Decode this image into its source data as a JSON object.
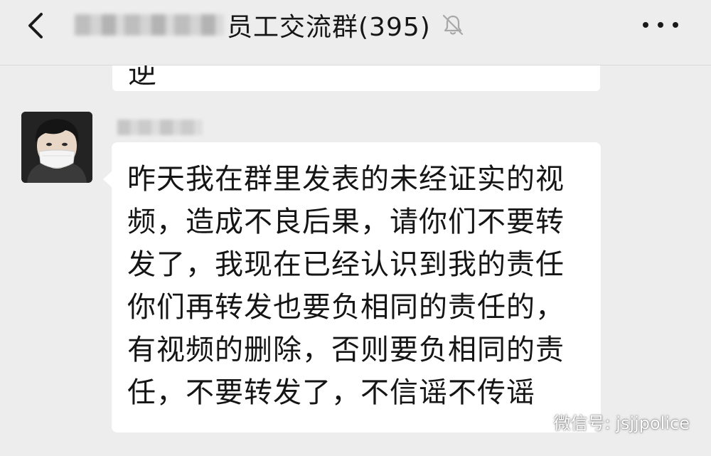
{
  "header": {
    "title": "员工交流群(395)",
    "back_icon": "chevron-left-icon",
    "mute_icon": "bell-muted-icon",
    "more_icon": "more-horizontal-icon"
  },
  "previous_message": {
    "partial_text": "逆"
  },
  "message": {
    "lines": [
      "昨天我在群里发表的未经证实的视",
      "频，造成不良后果，请你们不要转",
      "发了，我现在已经认识到我的责任",
      "你们再转发也要负相同的责任的，",
      "有视频的删除，否则要负相同的责",
      "任，不要转发了，不信谣不传谣"
    ]
  },
  "watermark": {
    "text": "微信号: jsjjpolice",
    "icon": "wechat-icon"
  },
  "colors": {
    "background": "#ededed",
    "bubble": "#ffffff",
    "text": "#151515"
  }
}
